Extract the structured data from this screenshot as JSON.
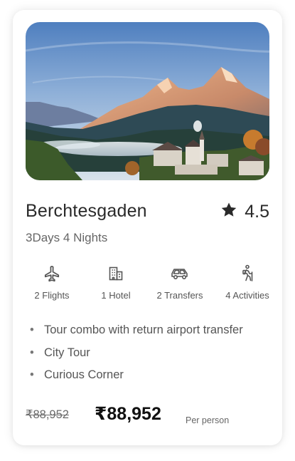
{
  "package": {
    "title": "Berchtesgaden",
    "rating": "4.5",
    "duration": "3Days 4 Nights",
    "features": [
      {
        "icon": "airplane-icon",
        "label": "2 Flights"
      },
      {
        "icon": "hotel-icon",
        "label": "1 Hotel"
      },
      {
        "icon": "car-icon",
        "label": "2 Transfers"
      },
      {
        "icon": "hiker-icon",
        "label": "4 Activities"
      }
    ],
    "highlights": [
      "Tour combo with return airport transfer",
      "City Tour",
      "Curious Corner"
    ],
    "original_price": "₹88,952",
    "price": "₹88,952",
    "price_unit": "Per person"
  },
  "colors": {
    "text_primary": "#2a2a2a",
    "text_secondary": "#666666",
    "icon": "#555555"
  }
}
